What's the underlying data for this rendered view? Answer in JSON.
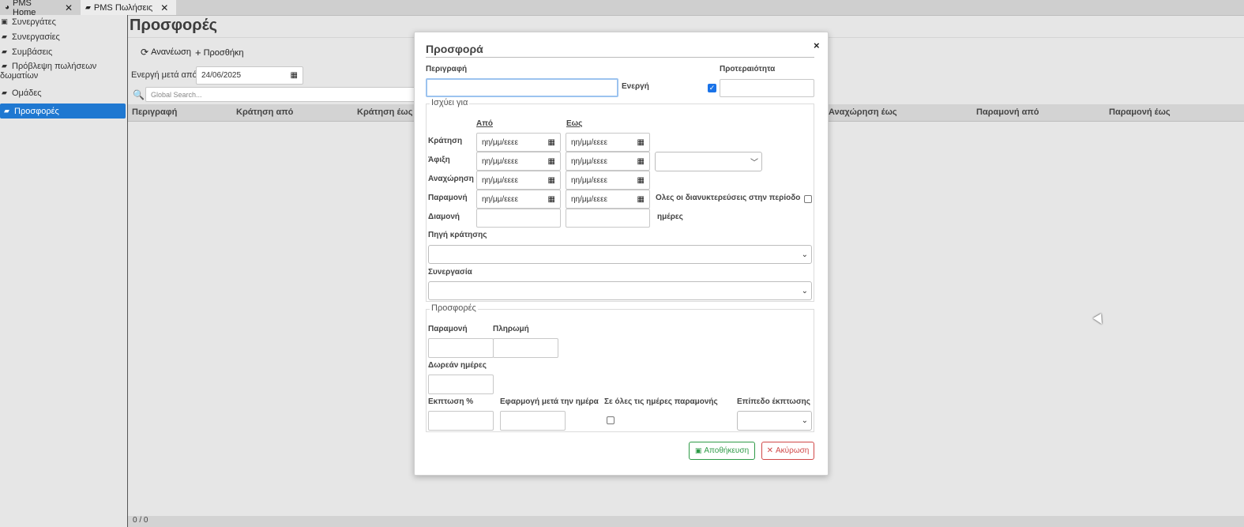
{
  "tabs": [
    {
      "label": "PMS Home",
      "icon": "pie-chart-icon"
    },
    {
      "label": "PMS Πωλήσεις",
      "icon": "handshake-icon"
    }
  ],
  "sidebar": {
    "items": [
      {
        "label": "Συνεργάτες",
        "icon": "address-book-icon"
      },
      {
        "label": "Συνεργασίες",
        "icon": "handshake-icon"
      },
      {
        "label": "Συμβάσεις",
        "icon": "handshake-icon"
      },
      {
        "label": "Πρόβλεψη πωλήσεων",
        "label2": "δωματίων",
        "icon": "handshake-icon"
      },
      {
        "label": "Ομάδες",
        "icon": "handshake-icon"
      },
      {
        "label": "Προσφορές",
        "icon": "handshake-icon",
        "active": true
      }
    ]
  },
  "main": {
    "title": "Προσφορές",
    "refresh_label": "Ανανέωση",
    "add_label": "Προσθήκη",
    "active_after_label": "Ενεργή μετά από",
    "active_after_value": "24/06/2025",
    "search_placeholder": "Global Search...",
    "columns": [
      "Περιγραφή",
      "Κράτηση από",
      "Κράτηση έως",
      "Αναχώρηση έως",
      "Παραμονή από",
      "Παραμονή έως"
    ],
    "footer": "0 / 0"
  },
  "modal": {
    "title": "Προσφορά",
    "close": "×",
    "description_label": "Περιγραφή",
    "active_label": "Ενεργή",
    "active_checked": true,
    "priority_label": "Προτεραιότητα",
    "valid_for_legend": "Ισχύει για",
    "from_label": "Από",
    "to_label": "Εως",
    "date_placeholder": "ηη/μμ/εεεε",
    "rows": {
      "booking": "Κράτηση",
      "arrival": "Άφιξη",
      "departure": "Αναχώρηση",
      "stay": "Παραμονή",
      "accommodation": "Διαμονή"
    },
    "all_overnights_label": "Ολες οι διανυκτερεύσεις στην περίοδο",
    "days_label": "ημέρες",
    "booking_source_label": "Πηγή κράτησης",
    "cooperation_label": "Συνεργασία",
    "offers_legend": "Προσφορές",
    "stay_label": "Παραμονή",
    "payment_label": "Πληρωμή",
    "free_days_label": "Δωρεάν ημέρες",
    "discount_label": "Εκπτωση %",
    "apply_after_label": "Εφαρμογή μετά την ημέρα",
    "all_days_label": "Σε όλες τις ημέρες παραμονής",
    "discount_level_label": "Επίπεδο έκπτωσης",
    "save_label": "Αποθήκευση",
    "cancel_label": "Ακύρωση"
  },
  "colors": {
    "accent": "#1f78d1",
    "save": "#2e9a47",
    "cancel": "#d04848"
  }
}
